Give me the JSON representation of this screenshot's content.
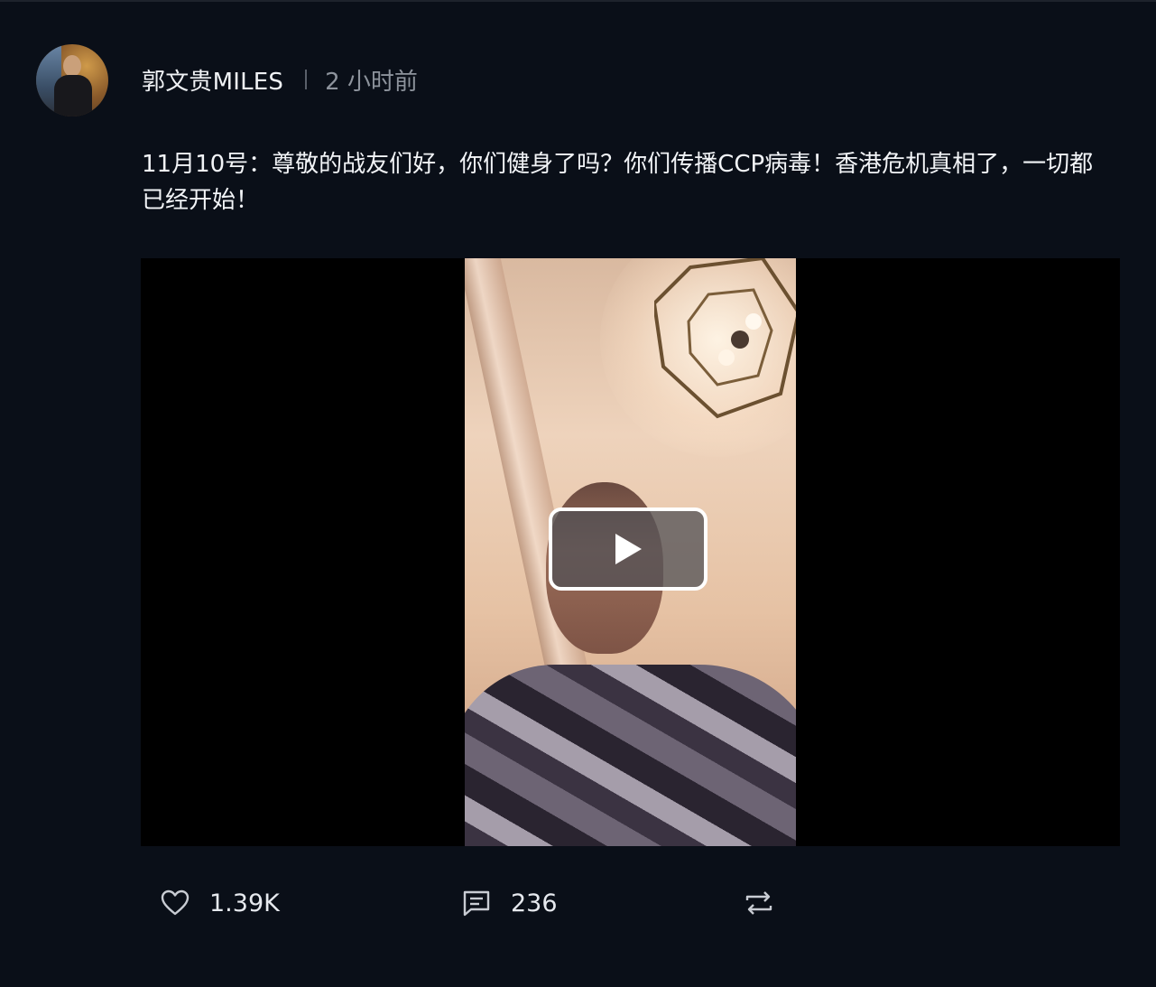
{
  "post": {
    "username": "郭文贵MILES",
    "time": "2 小时前",
    "text": "11月10号：尊敬的战友们好，你们健身了吗？你们传播CCP病毒！香港危机真相了，一切都已经开始！",
    "video": {
      "play_icon": "play-icon"
    },
    "actions": {
      "likes": "1.39K",
      "comments": "236",
      "like_icon": "heart-icon",
      "comment_icon": "comment-icon",
      "share_icon": "repost-icon"
    }
  },
  "colors": {
    "background": "#0a0f18",
    "text": "#f2f4f7",
    "muted": "#8d939c"
  }
}
